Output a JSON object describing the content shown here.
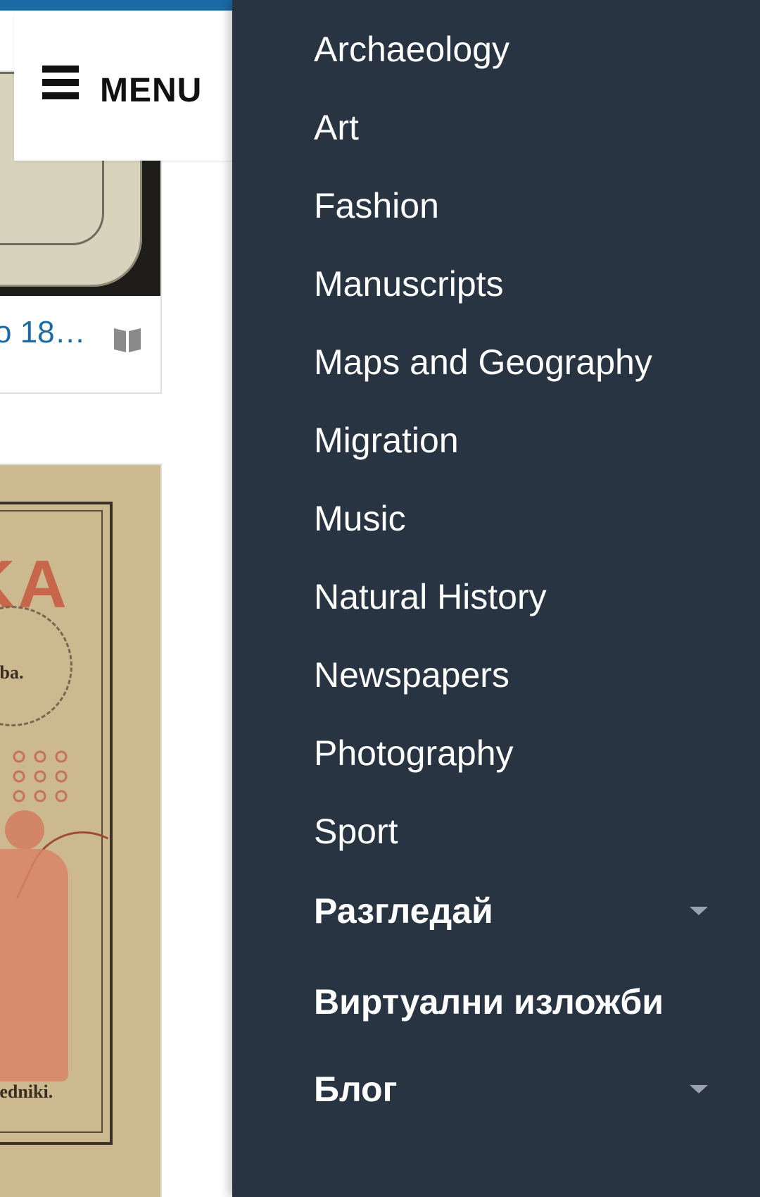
{
  "header": {
    "menu_label": "MENU"
  },
  "left_content": {
    "card1_caption": "o 18…",
    "card2_big_text": "KA",
    "card2_text1": "ružba.",
    "card2_text2": "sledniki."
  },
  "drawer": {
    "items": [
      {
        "label": "Archaeology"
      },
      {
        "label": "Art"
      },
      {
        "label": "Fashion"
      },
      {
        "label": "Manuscripts"
      },
      {
        "label": "Maps and Geography"
      },
      {
        "label": "Migration"
      },
      {
        "label": "Music"
      },
      {
        "label": "Natural History"
      },
      {
        "label": "Newspapers"
      },
      {
        "label": "Photography"
      },
      {
        "label": "Sport"
      }
    ],
    "sections": [
      {
        "label": "Разгледай",
        "has_dropdown": true
      },
      {
        "label": "Виртуални изложби",
        "has_dropdown": false
      },
      {
        "label": "Блог",
        "has_dropdown": true
      }
    ]
  },
  "colors": {
    "drawer_bg": "#283442",
    "accent": "#1b6aa5",
    "text_on_dark": "#ffffff",
    "caret": "#9aa3ad"
  }
}
